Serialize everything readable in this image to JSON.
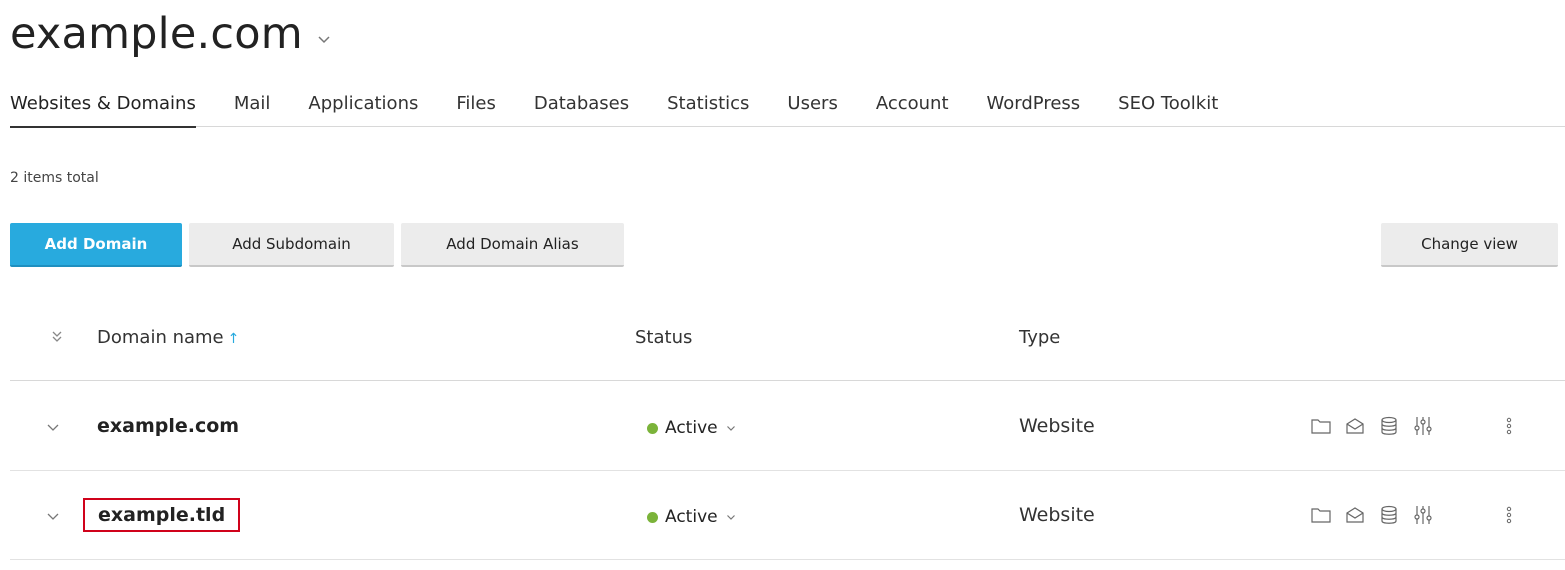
{
  "header": {
    "title": "example.com"
  },
  "tabs": [
    {
      "label": "Websites & Domains",
      "active": true
    },
    {
      "label": "Mail"
    },
    {
      "label": "Applications"
    },
    {
      "label": "Files"
    },
    {
      "label": "Databases"
    },
    {
      "label": "Statistics"
    },
    {
      "label": "Users"
    },
    {
      "label": "Account"
    },
    {
      "label": "WordPress"
    },
    {
      "label": "SEO Toolkit"
    }
  ],
  "list": {
    "items_total": "2 items total"
  },
  "toolbar": {
    "add_domain": "Add Domain",
    "add_subdomain": "Add Subdomain",
    "add_alias": "Add Domain Alias",
    "change_view": "Change view"
  },
  "table": {
    "columns": {
      "domain": "Domain name",
      "status": "Status",
      "type": "Type"
    },
    "sort_arrow": "↑",
    "rows": [
      {
        "domain": "example.com",
        "status": "Active",
        "type": "Website"
      },
      {
        "domain": "example.tld",
        "status": "Active",
        "type": "Website"
      }
    ]
  },
  "colors": {
    "accent": "#28aade",
    "status_active": "#7bb33a",
    "highlight": "#d0021b"
  },
  "icons": [
    "chevron-down-icon",
    "expand-all-icon",
    "folder-icon",
    "mail-icon",
    "database-icon",
    "settings-sliders-icon",
    "more-vertical-icon"
  ]
}
